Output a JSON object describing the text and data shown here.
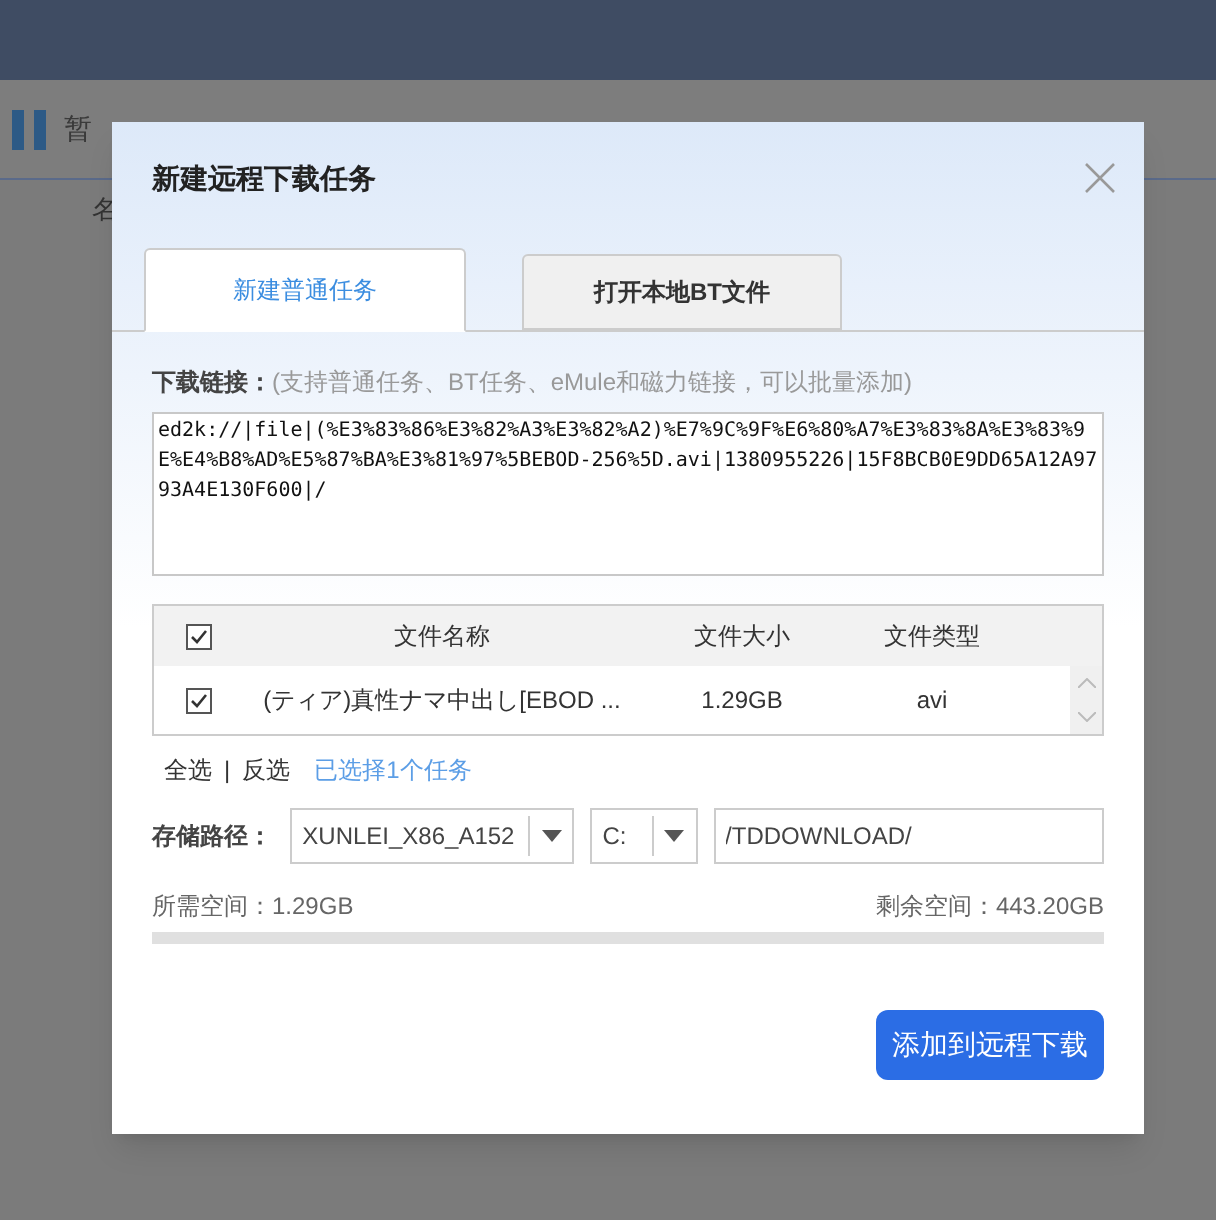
{
  "background": {
    "toolbar": {
      "pause_label": "暂"
    },
    "list_header": {
      "column_1": "名"
    }
  },
  "dialog": {
    "title": "新建远程下载任务",
    "tabs": [
      {
        "label": "新建普通任务",
        "selected": true
      },
      {
        "label": "打开本地BT文件",
        "selected": false
      }
    ],
    "link_label": "下载链接：",
    "link_hint": "(支持普通任务、BT任务、eMule和磁力链接，可以批量添加)",
    "link_value": "ed2k://|file|(%E3%83%86%E3%82%A3%E3%82%A2)%E7%9C%9F%E6%80%A7%E3%83%8A%E3%83%9E%E4%B8%AD%E5%87%BA%E3%81%97%5BEBOD-256%5D.avi|1380955226|15F8BCB0E9DD65A12A9793A4E130F600|/",
    "table": {
      "all_checked": true,
      "columns": [
        "文件名称",
        "文件大小",
        "文件类型"
      ],
      "rows": [
        {
          "checked": true,
          "name": "(ティア)真性ナマ中出し[EBOD ...",
          "size": "1.29GB",
          "type": "avi"
        }
      ]
    },
    "select_all": "全选",
    "separator": "|",
    "invert": "反选",
    "selected_count": "已选择1个任务",
    "path_label": "存储路径：",
    "device": "XUNLEI_X86_A152",
    "drive": "C:",
    "folder": "/TDDOWNLOAD/",
    "required_space": "所需空间：1.29GB",
    "free_space": "剩余空间：443.20GB",
    "submit": "添加到远程下载"
  }
}
